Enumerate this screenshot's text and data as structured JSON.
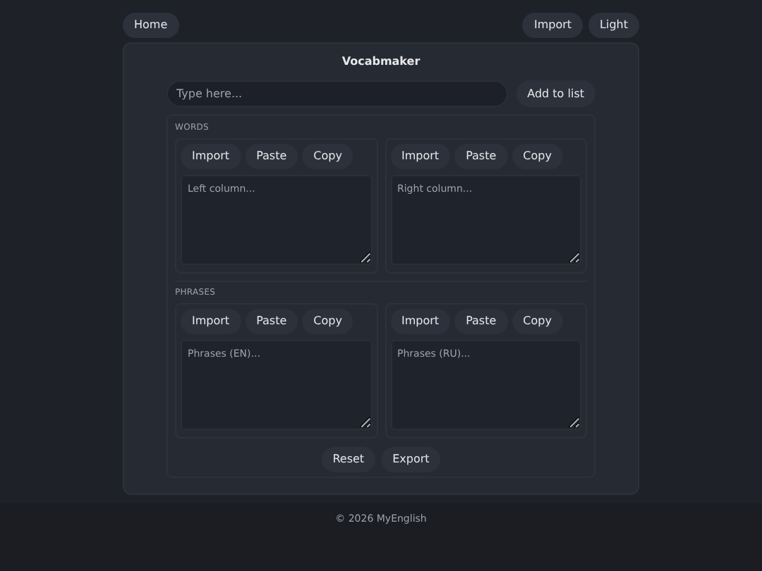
{
  "nav": {
    "home": "Home",
    "import": "Import",
    "theme": "Light"
  },
  "app": {
    "title": "Vocabmaker",
    "input": {
      "placeholder": "Type here..."
    },
    "add_button": "Add to list",
    "sections": [
      {
        "heading": "WORDS",
        "panels": [
          {
            "buttons": [
              "Import",
              "Paste",
              "Copy"
            ],
            "placeholder": "Left column..."
          },
          {
            "buttons": [
              "Import",
              "Paste",
              "Copy"
            ],
            "placeholder": "Right column..."
          }
        ]
      },
      {
        "heading": "PHRASES",
        "panels": [
          {
            "buttons": [
              "Import",
              "Paste",
              "Copy"
            ],
            "placeholder": "Phrases (EN)..."
          },
          {
            "buttons": [
              "Import",
              "Paste",
              "Copy"
            ],
            "placeholder": "Phrases (RU)..."
          }
        ]
      }
    ],
    "actions": [
      "Reset",
      "Export"
    ]
  },
  "footer": "© 2026 MyEnglish"
}
